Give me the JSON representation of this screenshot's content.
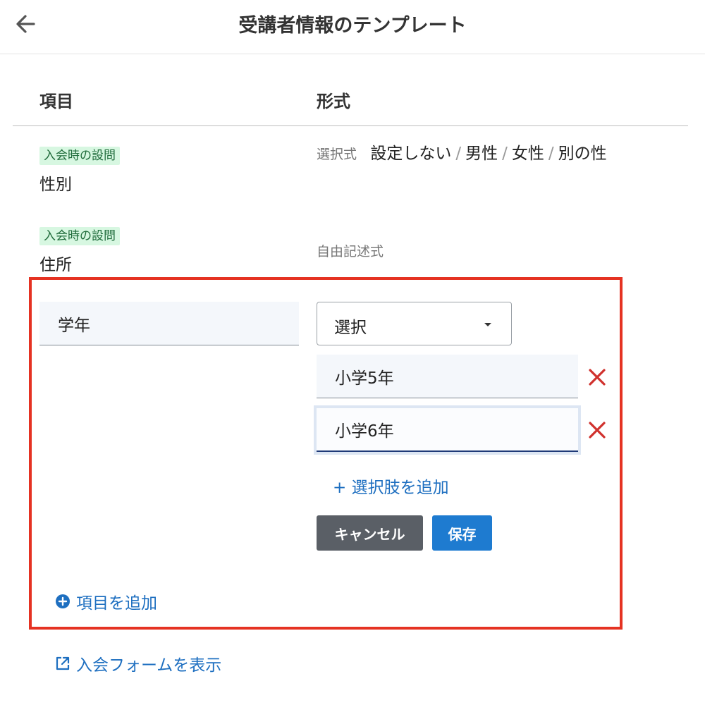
{
  "header": {
    "title": "受講者情報のテンプレート",
    "back_icon": "arrow-left-icon"
  },
  "table": {
    "col_item": "項目",
    "col_format": "形式"
  },
  "rows": [
    {
      "badge": "入会時の設問",
      "name": "性別",
      "format_label": "選択式",
      "options": [
        "設定しない",
        "男性",
        "女性",
        "別の性"
      ]
    },
    {
      "badge": "入会時の設問",
      "name": "住所",
      "format_label": "自由記述式"
    }
  ],
  "editor": {
    "item_value": "学年",
    "format_select": "選択",
    "choices": [
      "小学5年",
      "小学6年"
    ],
    "add_choice": "+ 選択肢を追加",
    "cancel": "キャンセル",
    "save": "保存",
    "add_item": "項目を追加"
  },
  "footer": {
    "view_form": "入会フォームを表示"
  },
  "colors": {
    "accent": "#1e6fc0",
    "highlight": "#e53222",
    "badge_bg": "#d7f7e1",
    "remove": "#d0312d"
  }
}
